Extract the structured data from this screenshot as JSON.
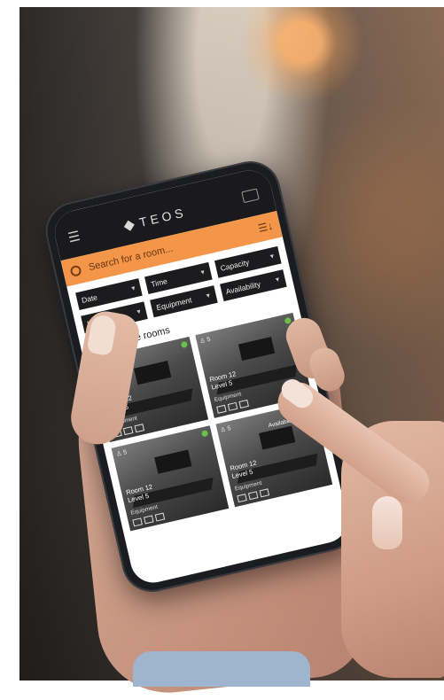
{
  "app": {
    "logo_text": "TEOS"
  },
  "header": {
    "menu_icon": "hamburger-icon",
    "cast_icon": "cast-screen-icon"
  },
  "search": {
    "placeholder": "Search for a room...",
    "sort_icon": "sort-filter-icon"
  },
  "filters": [
    "Date",
    "Time",
    "Capacity",
    "Location",
    "Equipment",
    "Availability"
  ],
  "results": {
    "count_text": "24 available rooms"
  },
  "rooms": [
    {
      "capacity": "5",
      "name": "Room 12",
      "level": "Level 5",
      "equipment_label": "Equipment",
      "status_color": "#6cc04a",
      "availability": ""
    },
    {
      "capacity": "5",
      "name": "Room 12",
      "level": "Level 5",
      "equipment_label": "Equipment",
      "status_color": "#6cc04a",
      "availability": ""
    },
    {
      "capacity": "5",
      "name": "Room 12",
      "level": "Level 5",
      "equipment_label": "Equipment",
      "status_color": "#6cc04a",
      "availability": ""
    },
    {
      "capacity": "5",
      "name": "Room 12",
      "level": "Level 5",
      "equipment_label": "Equipment",
      "status_color": "#f08a3c",
      "availability": "Available at 16:00"
    }
  ],
  "colors": {
    "accent": "#f3964a",
    "topbar": "#1a1a1c",
    "filter_bg": "#1c1c1e"
  }
}
